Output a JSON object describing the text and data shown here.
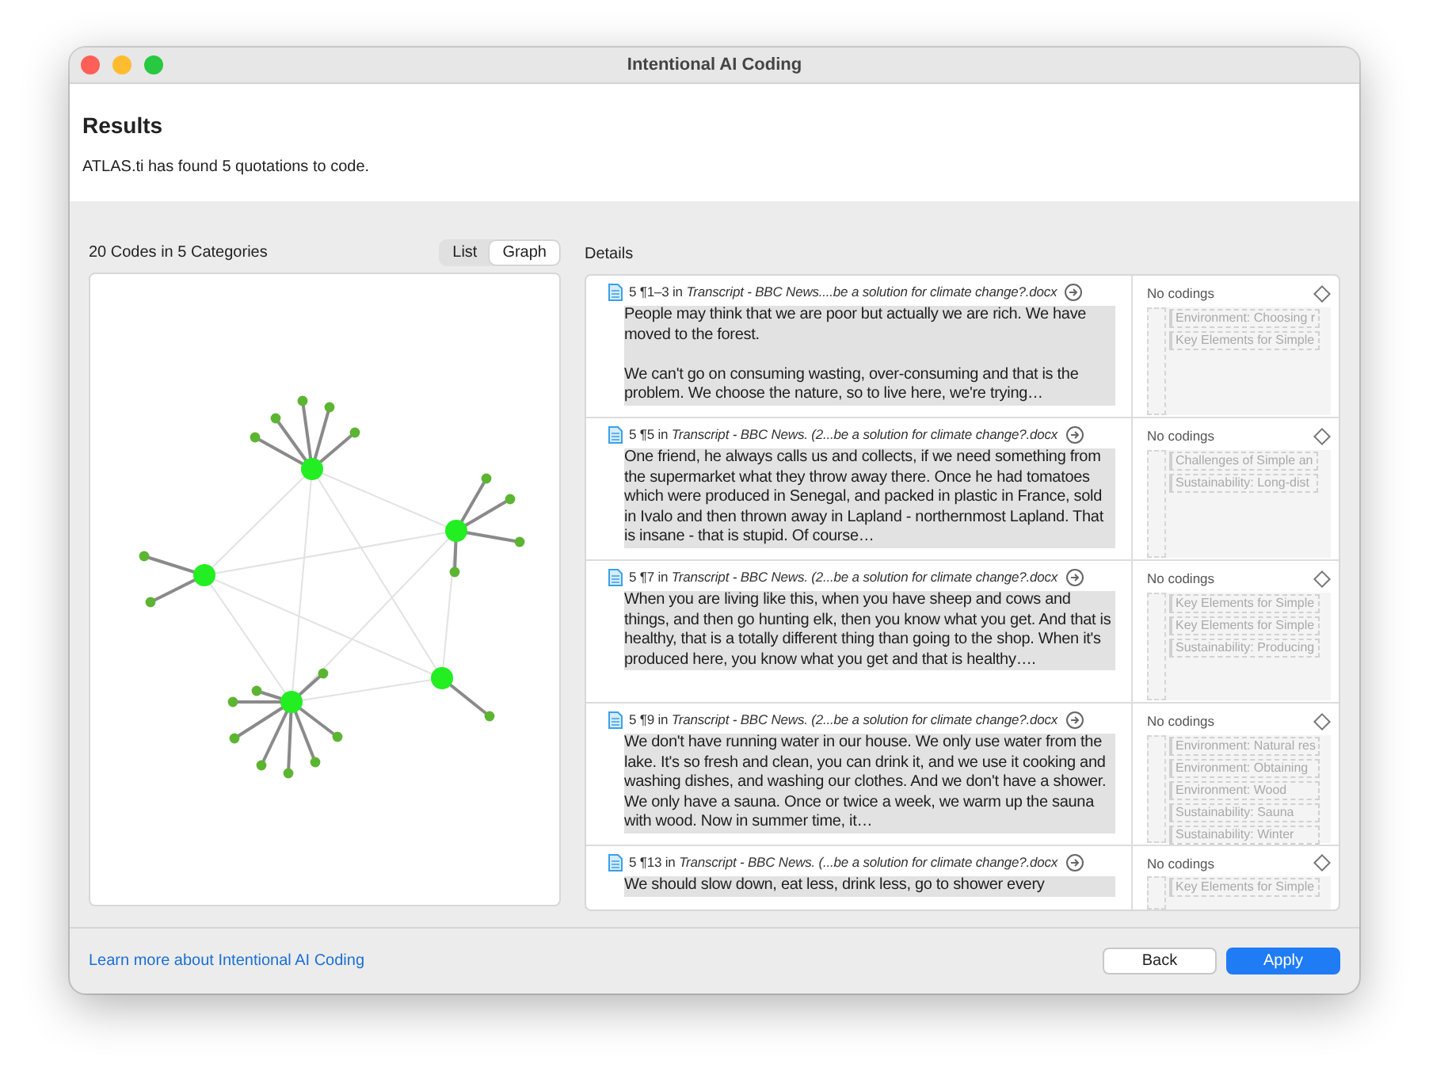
{
  "window": {
    "title": "Intentional AI Coding"
  },
  "header": {
    "title": "Results",
    "message": "ATLAS.ti has found 5 quotations to code."
  },
  "codes_panel": {
    "summary": "20 Codes in 5 Categories",
    "view_toggle": [
      {
        "label": "List",
        "selected": false
      },
      {
        "label": "Graph",
        "selected": true
      }
    ]
  },
  "details": {
    "title": "Details",
    "quotations": [
      {
        "reference": "5 ¶1–3 in *Transcript - BBC News....be a solution for climate change?.docx*",
        "text": "People may think that we are poor but actually we are rich. We have moved to the forest.\n\nWe can't go on consuming wasting, over-consuming and that is the problem. We choose the nature, so to live here, we're trying…",
        "codings": "No codings",
        "suggested_codes": [
          "Environment: Choosing r",
          "Key Elements for Simple"
        ]
      },
      {
        "reference": "5 ¶5 in *Transcript - BBC News. (2...be a solution for climate change?.docx*",
        "text": "One friend, he always calls us and collects, if we need something from the supermarket what they throw away there. Once he had tomatoes which were produced in Senegal, and packed in plastic in France, sold in Ivalo and then thrown away in Lapland - northernmost Lapland. That is insane - that is stupid. Of course…",
        "codings": "No codings",
        "suggested_codes": [
          "Challenges of Simple an",
          "Sustainability: Long-dist"
        ]
      },
      {
        "reference": "5 ¶7 in *Transcript - BBC News. (2...be a solution for climate change?.docx*",
        "text": "When you are living like this, when you have sheep and cows and things, and then go hunting elk, then you know what you get. And that is healthy, that is a totally different thing than going to the shop. When it's produced here, you know what you get and that is healthy….",
        "codings": "No codings",
        "suggested_codes": [
          "Key Elements for Simple",
          "Key Elements for Simple",
          "Sustainability: Producing"
        ]
      },
      {
        "reference": "5 ¶9 in *Transcript - BBC News. (2...be a solution for climate change?.docx*",
        "text": "We don't have running water in our house. We only use water from the lake. It's so fresh and clean, you can drink it, and we use it cooking and washing dishes, and washing our clothes. And we don't have a shower. We only have a sauna. Once or twice a week, we warm up the sauna with wood. Now in summer time, it…",
        "codings": "No codings",
        "suggested_codes": [
          "Environment: Natural res",
          "Environment: Obtaining",
          "Environment: Wood",
          "Sustainability: Sauna",
          "Sustainability: Winter"
        ]
      },
      {
        "reference": "5 ¶13 in *Transcript - BBC News. (...be a solution for climate change?.docx*",
        "text": "We should slow down, eat less, drink less, go to shower every",
        "codings": "No codings",
        "suggested_codes": [
          "Key Elements for Simple"
        ]
      }
    ]
  },
  "footer": {
    "link": "Learn more about Intentional AI Coding",
    "buttons": [
      {
        "label": "Back",
        "kind": "secondary"
      },
      {
        "label": "Apply",
        "kind": "primary"
      }
    ]
  }
}
